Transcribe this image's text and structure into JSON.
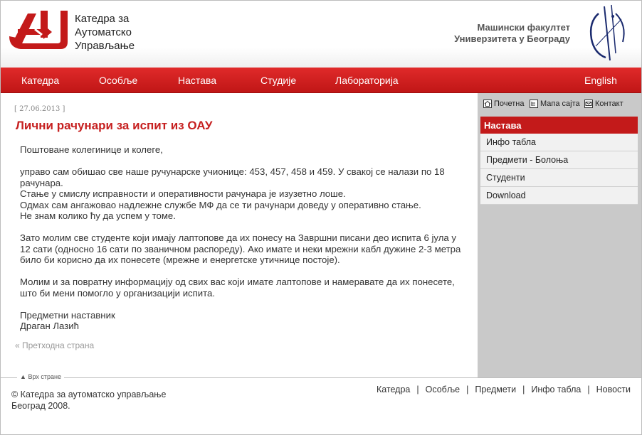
{
  "header": {
    "dept_line1": "Катедра за",
    "dept_line2": "Аутоматско",
    "dept_line3": "Управљање",
    "faculty_line1": "Машински факултет",
    "faculty_line2": "Универзитета у Београду"
  },
  "nav": {
    "items": [
      "Катедра",
      "Особље",
      "Настава",
      "Студије",
      "Лабораторија"
    ],
    "lang": "English"
  },
  "article": {
    "date": "[ 27.06.2013 ]",
    "title": "Лични рачунари за испит из ОАУ",
    "paragraphs": [
      "Поштоване колегинице и колеге,",
      "управо сам обишао све наше ручунарске учионице: 453, 457, 458 и 459. У свакој се налази по 18 рачунара.\nСтање у смислу исправности и оперативности рачунара је изузетно лоше.\nОдмах сам ангажовао надлежне службе МФ да се ти рачунари доведу у оперативно стање.\nНе знам колико ћу да успем у томе.",
      "Зато молим све студенте који имају лаптопове да их понесу на Завршни писани део испита 6 јула у 12 сати (односно 16 сати по званичном распореду). Ако имате и неки мрежни кабл дужине 2-3 метра било би корисно да их понесете (мрежне и енергетске утичнице постоје).",
      "Молим и за повратну информацију од свих вас који имате лаптопове и намеравате да их понесете, што би мени помогло у организацији испита.",
      "Предметни наставник\nДраган Лазић"
    ],
    "prev_link": "« Претходна страна"
  },
  "sidebar": {
    "util": [
      "Почетна",
      "Мапа сајта",
      "Контакт"
    ],
    "menu_title": "Настава",
    "menu_items": [
      "Инфо табла",
      "Предмети - Болоња",
      "Студенти",
      "Download"
    ]
  },
  "footer": {
    "top_link": "Врх стране",
    "copy_line1": "© Катедра за аутоматско управљање",
    "copy_line2": "Београд 2008.",
    "links": [
      "Катедра",
      "Особље",
      "Предмети",
      "Инфо табла",
      "Новости"
    ]
  },
  "colors": {
    "accent": "#c31a1a",
    "nav_bg": "#d42020",
    "sidebar_bg": "#c9c9c9"
  }
}
